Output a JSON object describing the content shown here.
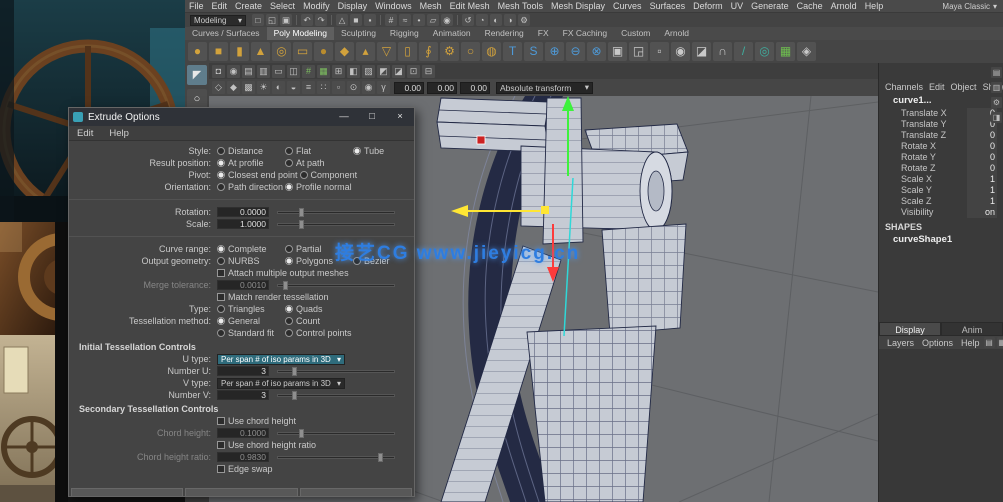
{
  "glyphs": {
    "dropdown_arrow": "▾",
    "window_minimize": "—",
    "window_maximize": "□",
    "window_close": "×"
  },
  "colors": {
    "accent": "#5285a6",
    "axis_x_red": "#fd3b3b",
    "axis_y_green": "#3df23d",
    "axis_z_blue": "#2fd8d8",
    "axis_selected_yellow": "#ffe634",
    "watermark_blue": "#2e7de0"
  },
  "watermark": {
    "text": "接艺CG  www.jieyicg.cn"
  },
  "menubar": {
    "items": [
      "File",
      "Edit",
      "Create",
      "Select",
      "Modify",
      "Display",
      "Windows",
      "Mesh",
      "Edit Mesh",
      "Mesh Tools",
      "Mesh Display",
      "Curves",
      "Surfaces",
      "Deform",
      "UV",
      "Generate",
      "Cache",
      "Arnold",
      "Help"
    ],
    "workspace": "Maya Classic"
  },
  "statusline": {
    "menu_set": "Modeling",
    "icons": [
      {
        "n": "new-scene-icon",
        "g": "□"
      },
      {
        "n": "open-scene-icon",
        "g": "◱"
      },
      {
        "n": "save-scene-icon",
        "g": "▣"
      },
      {
        "sep": true
      },
      {
        "n": "undo-icon",
        "g": "↶"
      },
      {
        "n": "redo-icon",
        "g": "↷"
      },
      {
        "sep": true
      },
      {
        "n": "select-hierarchy-icon",
        "g": "△"
      },
      {
        "n": "select-object-icon",
        "g": "■"
      },
      {
        "n": "select-component-icon",
        "g": "▪"
      },
      {
        "sep": true
      },
      {
        "n": "snap-to-grid-icon",
        "g": "#"
      },
      {
        "n": "snap-to-curve-icon",
        "g": "≈"
      },
      {
        "n": "snap-to-point-icon",
        "g": "•"
      },
      {
        "n": "snap-to-plane-icon",
        "g": "▱"
      },
      {
        "n": "make-live-icon",
        "g": "◉"
      },
      {
        "sep": true
      },
      {
        "n": "construction-history-icon",
        "g": "↺"
      },
      {
        "n": "render-view-icon",
        "g": "◔"
      },
      {
        "n": "render-frame-icon",
        "g": "◐"
      },
      {
        "n": "ipr-render-icon",
        "g": "◑"
      },
      {
        "n": "render-settings-icon",
        "g": "⚙"
      }
    ]
  },
  "shelf": {
    "tabs": [
      "Curves / Surfaces",
      "Poly Modeling",
      "Sculpting",
      "Rigging",
      "Animation",
      "Rendering",
      "FX",
      "FX Caching",
      "Custom",
      "Arnold"
    ],
    "active_tab": 1,
    "icons": [
      {
        "n": "poly-sphere-icon",
        "g": "●",
        "c": "#d2a23c"
      },
      {
        "n": "poly-cube-icon",
        "g": "■",
        "c": "#d2a23c"
      },
      {
        "n": "poly-cylinder-icon",
        "g": "▮",
        "c": "#d2a23c"
      },
      {
        "n": "poly-cone-icon",
        "g": "▲",
        "c": "#d2a23c"
      },
      {
        "n": "poly-torus-icon",
        "g": "◎",
        "c": "#d2a23c"
      },
      {
        "n": "poly-plane-icon",
        "g": "▭",
        "c": "#d2a23c"
      },
      {
        "n": "poly-disc-icon",
        "g": "●",
        "c": "#b98c2e"
      },
      {
        "n": "poly-platonic-icon",
        "g": "◆",
        "c": "#d2a23c"
      },
      {
        "n": "poly-pyramid-icon",
        "g": "▴",
        "c": "#d2a23c"
      },
      {
        "n": "poly-prism-icon",
        "g": "▽",
        "c": "#d2a23c"
      },
      {
        "n": "poly-pipe-icon",
        "g": "▯",
        "c": "#d2a23c"
      },
      {
        "n": "poly-helix-icon",
        "g": "∮",
        "c": "#d2a23c"
      },
      {
        "n": "poly-gear-icon",
        "g": "⚙",
        "c": "#d2a23c"
      },
      {
        "n": "poly-soccer-ball-icon",
        "g": "○",
        "c": "#d2a23c"
      },
      {
        "n": "poly-superellipse-icon",
        "g": "◍",
        "c": "#d2a23c"
      },
      {
        "n": "poly-type-icon",
        "g": "T",
        "c": "#4e9ad8"
      },
      {
        "n": "poly-svg-icon",
        "g": "S",
        "c": "#4e9ad8"
      },
      {
        "n": "boolean-union-icon",
        "g": "⊕",
        "c": "#4e9ad8"
      },
      {
        "n": "boolean-difference-icon",
        "g": "⊖",
        "c": "#4e9ad8"
      },
      {
        "n": "boolean-intersection-icon",
        "g": "⊗",
        "c": "#4e9ad8"
      },
      {
        "n": "combine-icon",
        "g": "▣",
        "c": "#c9c9c9"
      },
      {
        "n": "separate-icon",
        "g": "◲",
        "c": "#c9c9c9"
      },
      {
        "n": "extract-icon",
        "g": "▫",
        "c": "#c9c9c9"
      },
      {
        "n": "smooth-icon",
        "g": "◉",
        "c": "#c9c9c9"
      },
      {
        "n": "bevel-icon",
        "g": "◪",
        "c": "#c9c9c9"
      },
      {
        "n": "bridge-icon",
        "g": "∩",
        "c": "#c9c9c9"
      },
      {
        "n": "multi-cut-icon",
        "g": "/",
        "c": "#3fae9f"
      },
      {
        "n": "target-weld-icon",
        "g": "◎",
        "c": "#3fae9f"
      },
      {
        "n": "quad-draw-icon",
        "g": "▦",
        "c": "#6fbf4f"
      },
      {
        "n": "mirror-icon",
        "g": "◈",
        "c": "#c9c9c9"
      }
    ]
  },
  "panel_menu_icons": [
    {
      "n": "select-camera-icon",
      "g": "◘"
    },
    {
      "n": "lock-camera-icon",
      "g": "◉"
    },
    {
      "n": "camera-attributes-icon",
      "g": "▤"
    },
    {
      "n": "bookmarks-icon",
      "g": "▥"
    },
    {
      "n": "image-plane-icon",
      "g": "▭"
    },
    {
      "n": "two-panes-icon",
      "g": "◫"
    },
    {
      "n": "grid-toggle-icon",
      "g": "#",
      "c": "#7dbf5f"
    },
    {
      "n": "film-gate-icon",
      "g": "▦",
      "c": "#7dbf5f"
    },
    {
      "n": "resolution-gate-icon",
      "g": "⊞"
    },
    {
      "n": "gate-mask-icon",
      "g": "◧"
    },
    {
      "n": "field-chart-icon",
      "g": "▨"
    },
    {
      "n": "safe-action-icon",
      "g": "◩"
    },
    {
      "n": "safe-title-icon",
      "g": "◪"
    },
    {
      "n": "frame-all-icon",
      "g": "⊡"
    },
    {
      "n": "frame-selection-icon",
      "g": "⊟"
    }
  ],
  "panel_toolbar": {
    "icons": [
      {
        "n": "wireframe-icon",
        "g": "◇"
      },
      {
        "n": "shaded-icon",
        "g": "◆"
      },
      {
        "n": "textured-icon",
        "g": "▩"
      },
      {
        "n": "lights-icon",
        "g": "☀"
      },
      {
        "n": "shadows-icon",
        "g": "◐"
      },
      {
        "n": "ambient-occlusion-icon",
        "g": "◒"
      },
      {
        "n": "motion-blur-icon",
        "g": "≡"
      },
      {
        "n": "multisample-icon",
        "g": "∷"
      },
      {
        "n": "xray-icon",
        "g": "▫"
      },
      {
        "n": "isolate-select-icon",
        "g": "⊙"
      },
      {
        "n": "exposure-icon",
        "g": "◉"
      },
      {
        "n": "gamma-icon",
        "g": "γ"
      }
    ],
    "fields": [
      "0.00",
      "0.00",
      "0.00"
    ],
    "mode_dropdown": "Absolute transform"
  },
  "toolbox": {
    "icons": [
      {
        "n": "select-tool-icon",
        "g": "◤"
      },
      {
        "n": "lasso-tool-icon",
        "g": "○"
      }
    ]
  },
  "channelbox": {
    "menu": [
      "Channels",
      "Edit",
      "Object",
      "Show"
    ],
    "object_name": "curve1...",
    "attrs": [
      {
        "name": "Translate X",
        "value": "0"
      },
      {
        "name": "Translate Y",
        "value": "0"
      },
      {
        "name": "Translate Z",
        "value": "0"
      },
      {
        "name": "Rotate X",
        "value": "0"
      },
      {
        "name": "Rotate Y",
        "value": "0"
      },
      {
        "name": "Rotate Z",
        "value": "0"
      },
      {
        "name": "Scale X",
        "value": "1"
      },
      {
        "name": "Scale Y",
        "value": "1"
      },
      {
        "name": "Scale Z",
        "value": "1"
      },
      {
        "name": "Visibility",
        "value": "on"
      }
    ],
    "shapes_label": "SHAPES",
    "shape_name": "curveShape1"
  },
  "sidebar_icons": [
    {
      "n": "channel-box-icon",
      "g": "▤"
    },
    {
      "n": "attribute-editor-icon",
      "g": "▥"
    },
    {
      "n": "tool-settings-icon",
      "g": "⚙"
    },
    {
      "n": "modeling-toolkit-icon",
      "g": "◨"
    }
  ],
  "layer_editor": {
    "tabs": [
      "Display",
      "Anim"
    ],
    "active_tab": 0,
    "menu": [
      "Layers",
      "Options",
      "Help"
    ],
    "icons": [
      {
        "n": "new-empty-layer-icon",
        "g": "▤"
      },
      {
        "n": "new-layer-from-selected-icon",
        "g": "▦"
      }
    ]
  },
  "dialog": {
    "title": "Extrude Options",
    "menu": [
      "Edit",
      "Help"
    ],
    "rows": [
      {
        "t": "radio",
        "label": "Style:",
        "opts": [
          "Distance",
          "Flat",
          "Tube"
        ],
        "sel": 2
      },
      {
        "t": "radio",
        "label": "Result position:",
        "opts": [
          "At profile",
          "At path"
        ],
        "sel": 0
      },
      {
        "t": "radio",
        "label": "Pivot:",
        "opts": [
          "Closest end point",
          "Component"
        ],
        "sel": 0
      },
      {
        "t": "radio",
        "label": "Orientation:",
        "opts": [
          "Path direction",
          "Profile normal"
        ],
        "sel": 1
      },
      {
        "t": "sep"
      },
      {
        "t": "slider",
        "label": "Rotation:",
        "value": "0.0000",
        "pos": 18
      },
      {
        "t": "slider",
        "label": "Scale:",
        "value": "1.0000",
        "pos": 18
      },
      {
        "t": "sep"
      },
      {
        "t": "radio",
        "label": "Curve range:",
        "opts": [
          "Complete",
          "Partial"
        ],
        "sel": 0
      },
      {
        "t": "radio",
        "label": "Output geometry:",
        "opts": [
          "NURBS",
          "Polygons",
          "Bezier"
        ],
        "sel": 1
      },
      {
        "t": "check",
        "label": "Attach multiple output meshes",
        "checked": false
      },
      {
        "t": "slider",
        "label": "Merge tolerance:",
        "value": "0.0010",
        "pos": 4,
        "disabled": true
      },
      {
        "t": "check",
        "label": "Match render tessellation",
        "checked": false
      },
      {
        "t": "radio",
        "label": "Type:",
        "opts": [
          "Triangles",
          "Quads"
        ],
        "sel": 1
      },
      {
        "t": "radio",
        "label": "Tessellation method:",
        "opts": [
          "General",
          "Count"
        ],
        "sel": 0
      },
      {
        "t": "radio",
        "label": "",
        "opts": [
          "Standard fit",
          "Control points"
        ],
        "sel": -1
      },
      {
        "t": "header",
        "label": "Initial Tessellation Controls"
      },
      {
        "t": "dropdown",
        "label": "U type:",
        "value": "Per span # of iso params in 3D",
        "highlight": true
      },
      {
        "t": "slider",
        "label": "Number U:",
        "value": "3",
        "pos": 12
      },
      {
        "t": "dropdown",
        "label": "V type:",
        "value": "Per span # of iso params in 3D",
        "highlight": false
      },
      {
        "t": "slider",
        "label": "Number V:",
        "value": "3",
        "pos": 12
      },
      {
        "t": "header",
        "label": "Secondary Tessellation Controls"
      },
      {
        "t": "check",
        "label": "Use chord height",
        "checked": false
      },
      {
        "t": "slider",
        "label": "Chord height:",
        "value": "0.1000",
        "pos": 18,
        "disabled": true
      },
      {
        "t": "check",
        "label": "Use chord height ratio",
        "checked": false
      },
      {
        "t": "slider",
        "label": "Chord height ratio:",
        "value": "0.9830",
        "pos": 86,
        "disabled": true
      },
      {
        "t": "check",
        "label": "Edge swap",
        "checked": false
      }
    ]
  }
}
